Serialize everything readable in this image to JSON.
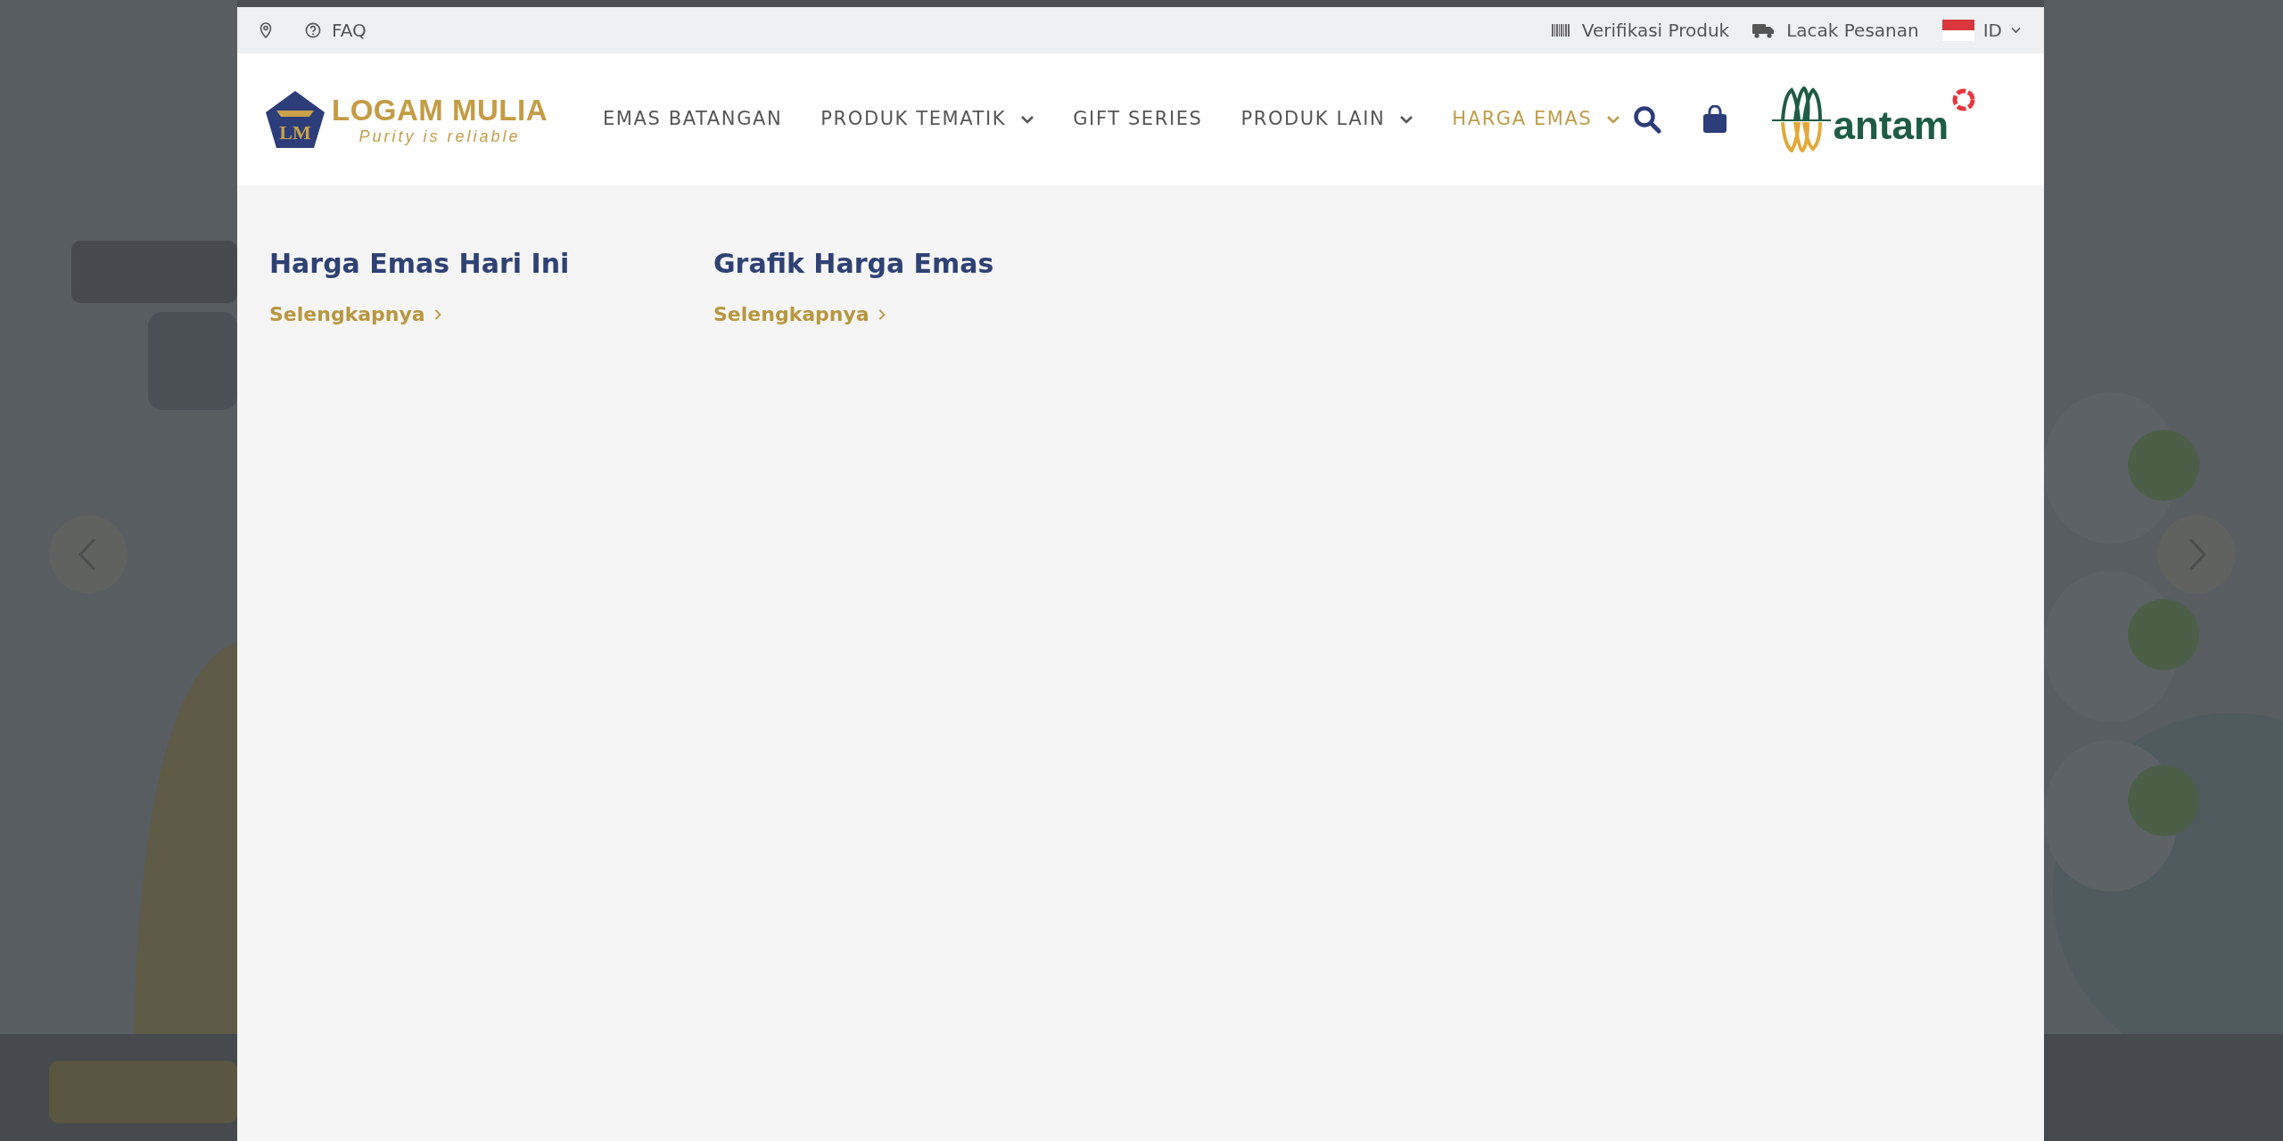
{
  "topbar": {
    "left": [
      {
        "kind": "location"
      },
      {
        "kind": "help",
        "label": "FAQ"
      }
    ],
    "right": [
      {
        "kind": "barcode",
        "label": "Verifikasi Produk"
      },
      {
        "kind": "truck",
        "label": "Lacak Pesanan"
      }
    ],
    "language": "ID"
  },
  "brand": {
    "monogram": "LM",
    "name": "LOGAM MULIA",
    "tagline": "Purity is reliable"
  },
  "nav": [
    {
      "label": "EMAS BATANGAN",
      "dropdown": false,
      "selected": false
    },
    {
      "label": "PRODUK TEMATIK",
      "dropdown": true,
      "selected": false
    },
    {
      "label": "GIFT SERIES",
      "dropdown": false,
      "selected": false
    },
    {
      "label": "PRODUK LAIN",
      "dropdown": true,
      "selected": false
    },
    {
      "label": "HARGA EMAS",
      "dropdown": true,
      "selected": true
    }
  ],
  "partner_logo": "antam",
  "menu": [
    {
      "title": "Harga Emas Hari Ini",
      "link": "Selengkapnya"
    },
    {
      "title": "Grafik Harga Emas",
      "link": "Selengkapnya"
    }
  ]
}
